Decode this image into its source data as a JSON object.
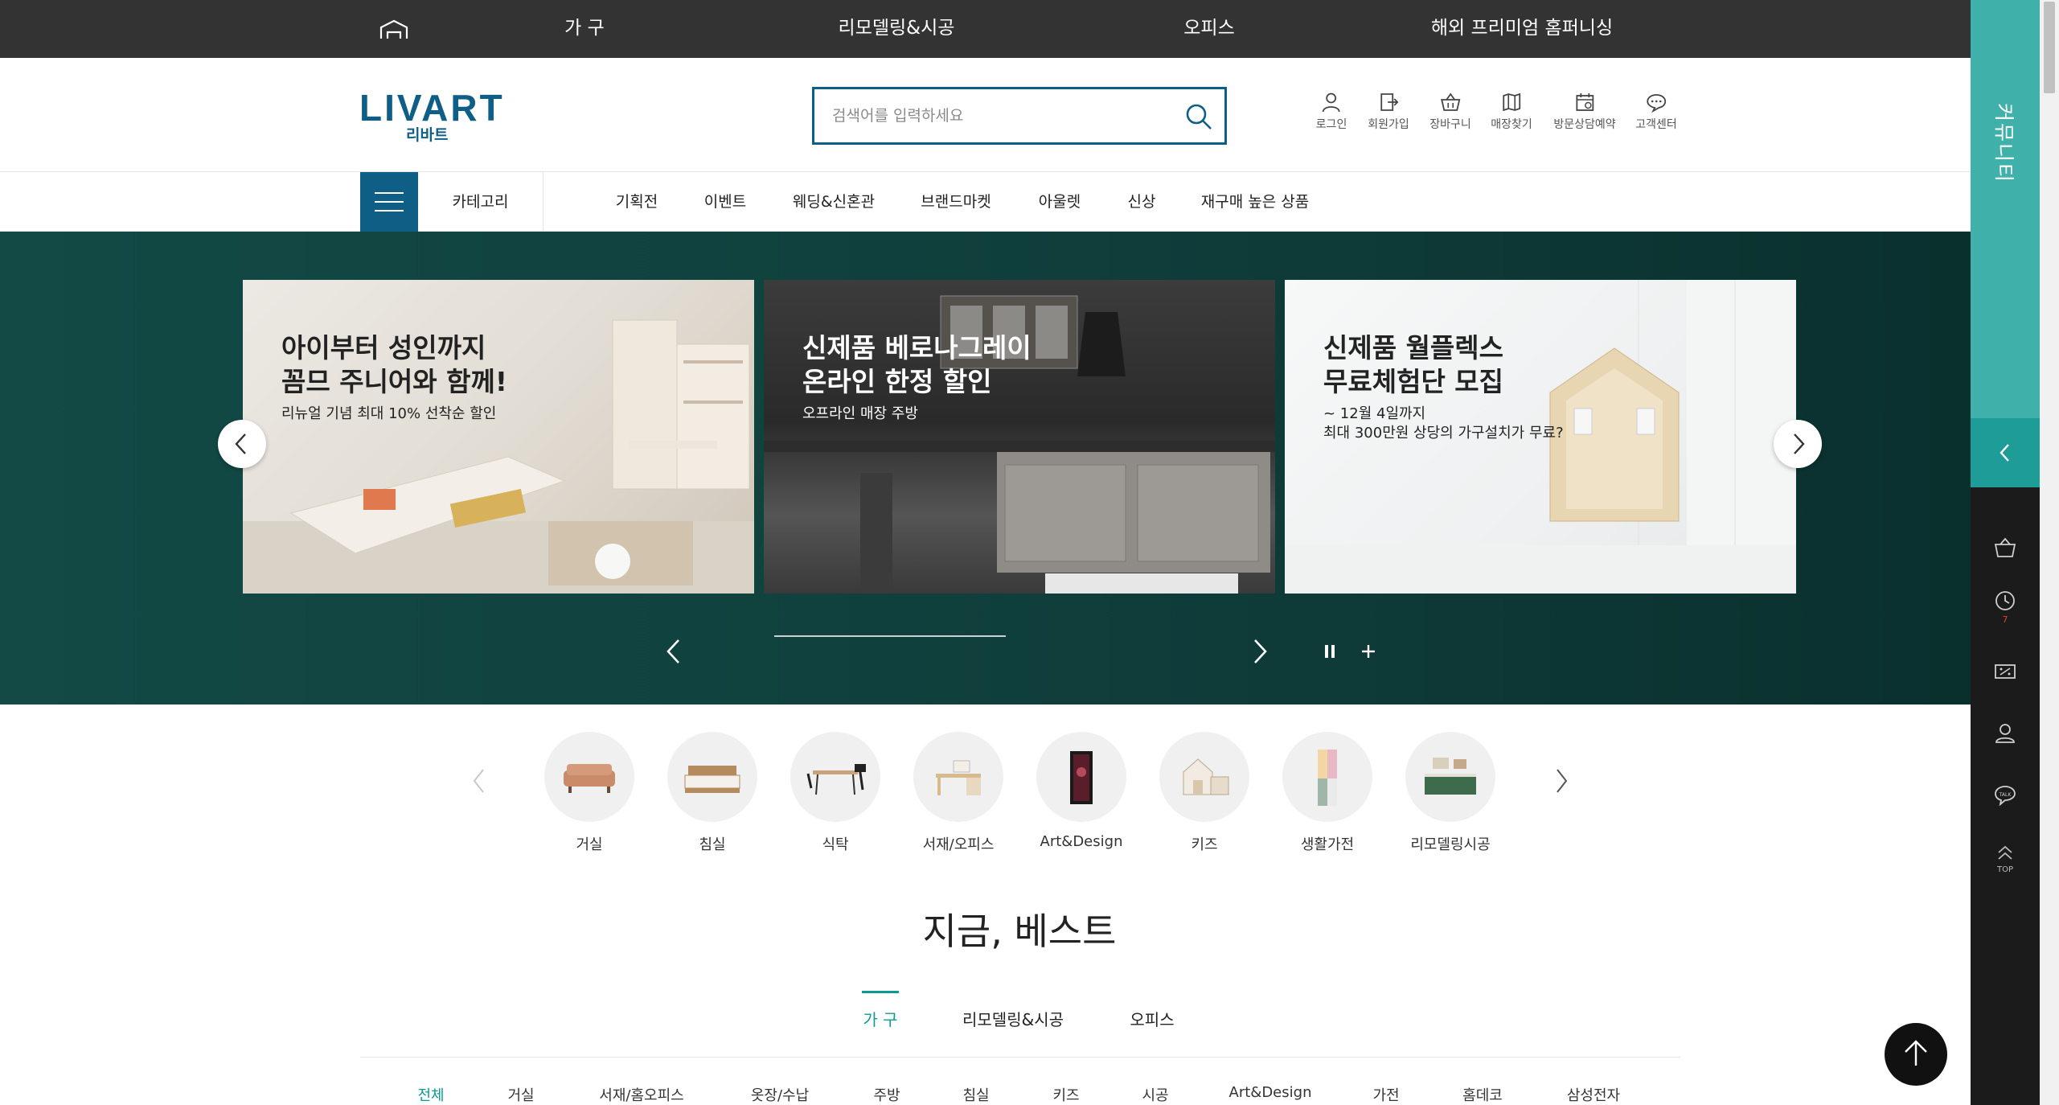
{
  "topbar": {
    "items": [
      "가 구",
      "리모델링&시공",
      "오피스",
      "해외 프리미엄 홈퍼니싱"
    ]
  },
  "header": {
    "logo_text": "LIVART",
    "logo_sub": "리바트",
    "search_placeholder": "검색어를 입력하세요",
    "utilities": [
      "로그인",
      "회원가입",
      "장바구니",
      "매장찾기",
      "방문상담예약",
      "고객센터"
    ]
  },
  "nav": {
    "category_label": "카테고리",
    "items": [
      "기획전",
      "이벤트",
      "웨딩&신혼관",
      "브랜드마켓",
      "아울렛",
      "신상",
      "재구매 높은 상품"
    ]
  },
  "hero": {
    "banners": [
      {
        "title": "아이부터 성인까지\n꼼므 주니어와 함께!",
        "subtitle": "리뉴얼 기념 최대 10% 선착순 할인"
      },
      {
        "title": "신제품 베로나그레이\n온라인 한정 할인",
        "subtitle": "오프라인 매장 주방"
      },
      {
        "title": "신제품 월플렉스\n무료체험단 모집",
        "subtitle": "~ 12월 4일까지\n최대 300만원 상당의 가구설치가 무료?"
      }
    ],
    "play_state": "paused"
  },
  "categories": {
    "items": [
      "거실",
      "침실",
      "식탁",
      "서재/오피스",
      "Art&Design",
      "키즈",
      "생활가전",
      "리모델링시공"
    ]
  },
  "best": {
    "title": "지금, 베스트",
    "tabs": [
      "가 구",
      "리모델링&시공",
      "오피스"
    ],
    "active_tab": "가 구",
    "sub_tabs": [
      "전체",
      "거실",
      "서재/홈오피스",
      "옷장/수납",
      "주방",
      "침실",
      "키즈",
      "시공",
      "Art&Design",
      "가전",
      "홈데코",
      "삼성전자"
    ],
    "active_sub_tab": "전체"
  },
  "sidebar": {
    "community_label": "커뮤니티",
    "recent_count": "7",
    "top_label": "TOP",
    "icons": [
      "cart-icon",
      "recent-view-icon",
      "coupon-icon",
      "store-location-icon",
      "talk-icon"
    ]
  },
  "colors": {
    "brand_blue": "#0e5e86",
    "accent_teal": "#0a9b94",
    "hero_bg": "#0f3e3b",
    "sidebar_teal": "#3fb0aa",
    "topbar_bg": "#333333"
  }
}
